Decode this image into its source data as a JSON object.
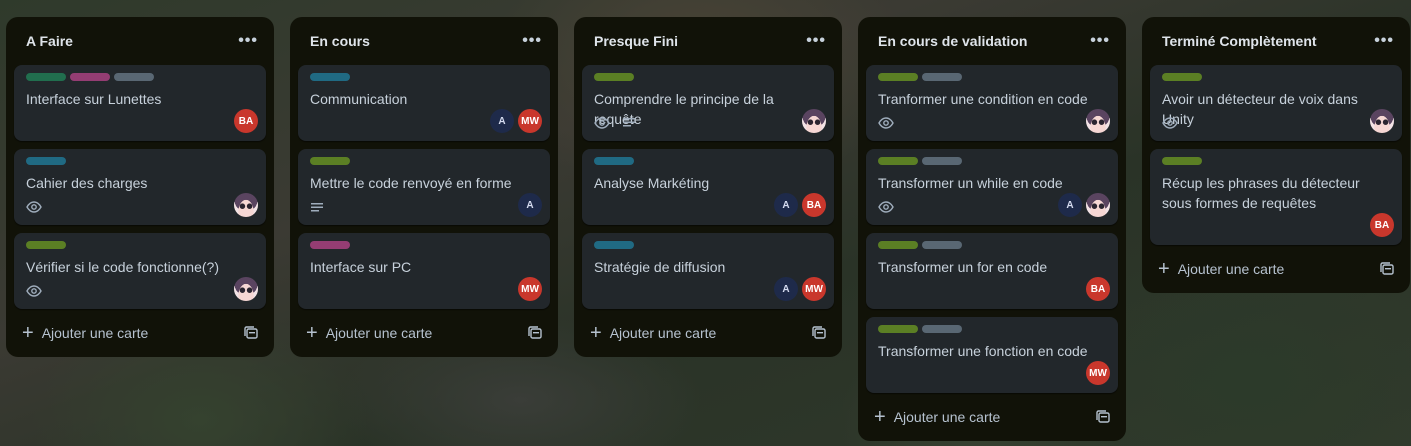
{
  "colors": {
    "green": "#4e6b23",
    "darkgreen": "#216e4e",
    "pink": "#943d73",
    "gray": "#596773",
    "teal": "#206a83",
    "olive": "#5b7f24"
  },
  "lists": [
    {
      "title": "A Faire",
      "add_label": "Ajouter une carte",
      "cards": [
        {
          "title": "Interface sur Lunettes",
          "labels": [
            "darkgreen",
            "pink",
            "gray"
          ],
          "badges": [],
          "members": [
            "BA"
          ]
        },
        {
          "title": "Cahier des charges",
          "labels": [
            "teal"
          ],
          "badges": [
            "eye"
          ],
          "members": [
            "anime"
          ]
        },
        {
          "title": "Vérifier si le code fonctionne(?)",
          "labels": [
            "olive"
          ],
          "badges": [
            "eye"
          ],
          "members": [
            "anime"
          ]
        }
      ]
    },
    {
      "title": "En cours",
      "add_label": "Ajouter une carte",
      "cards": [
        {
          "title": "Communication",
          "labels": [
            "teal"
          ],
          "badges": [],
          "members": [
            "A",
            "MW"
          ]
        },
        {
          "title": "Mettre le code renvoyé en forme",
          "labels": [
            "olive"
          ],
          "badges": [
            "desc"
          ],
          "members": [
            "A"
          ]
        },
        {
          "title": "Interface sur PC",
          "labels": [
            "pink"
          ],
          "badges": [],
          "members": [
            "MW"
          ]
        }
      ]
    },
    {
      "title": "Presque Fini",
      "add_label": "Ajouter une carte",
      "cards": [
        {
          "title": "Comprendre le principe de la requête",
          "labels": [
            "olive"
          ],
          "badges": [
            "eye",
            "desc"
          ],
          "members": [
            "anime"
          ]
        },
        {
          "title": "Analyse Markéting",
          "labels": [
            "teal"
          ],
          "badges": [],
          "members": [
            "A",
            "BA"
          ]
        },
        {
          "title": "Stratégie de diffusion",
          "labels": [
            "teal"
          ],
          "badges": [],
          "members": [
            "A",
            "MW"
          ]
        }
      ]
    },
    {
      "title": "En cours de validation",
      "add_label": "Ajouter une carte",
      "cards": [
        {
          "title": "Tranformer une condition en code",
          "labels": [
            "olive",
            "gray"
          ],
          "badges": [
            "eye"
          ],
          "members": [
            "anime"
          ]
        },
        {
          "title": "Transformer un while en code",
          "labels": [
            "olive",
            "gray"
          ],
          "badges": [
            "eye"
          ],
          "members": [
            "A",
            "anime"
          ]
        },
        {
          "title": "Transformer un for en code",
          "labels": [
            "olive",
            "gray"
          ],
          "badges": [],
          "members": [
            "BA"
          ]
        },
        {
          "title": "Transformer une fonction en code",
          "labels": [
            "olive",
            "gray"
          ],
          "badges": [],
          "members": [
            "MW"
          ]
        }
      ]
    },
    {
      "title": "Terminé Complètement",
      "add_label": "Ajouter une carte",
      "cards": [
        {
          "title": "Avoir un détecteur de voix dans Unity",
          "labels": [
            "olive"
          ],
          "badges": [
            "eye"
          ],
          "members": [
            "anime"
          ]
        },
        {
          "title": "Récup les phrases du détecteur sous formes de requêtes",
          "labels": [
            "olive"
          ],
          "badges": [],
          "members": [
            "BA"
          ],
          "tall": true
        }
      ]
    }
  ]
}
